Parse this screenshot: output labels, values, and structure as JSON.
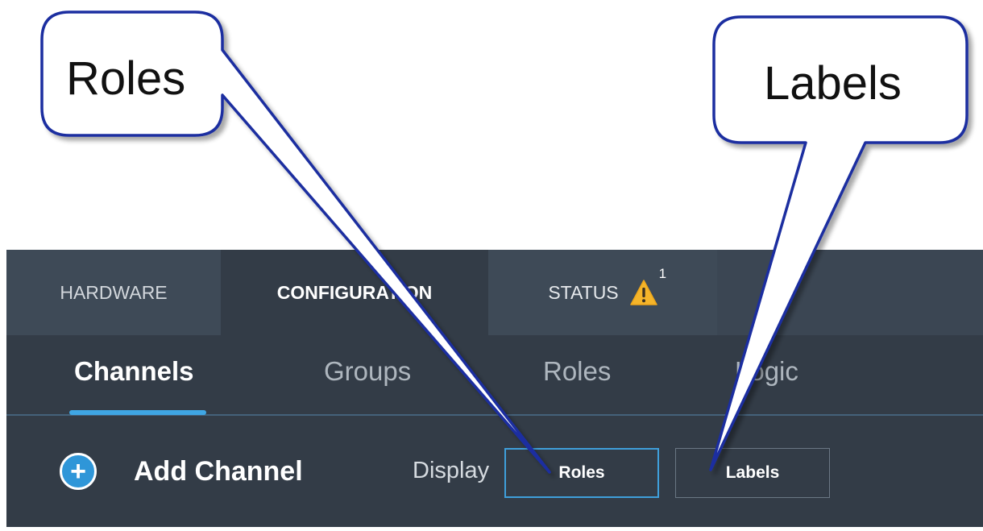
{
  "callouts": {
    "roles": "Roles",
    "labels": "Labels"
  },
  "top_tabs": {
    "hardware": "HARDWARE",
    "configuration": "CONFIGURATION",
    "status": "STATUS",
    "status_badge_count": "1"
  },
  "sub_tabs": {
    "channels": "Channels",
    "groups": "Groups",
    "roles": "Roles",
    "logic": "Logic"
  },
  "toolbar": {
    "add_icon": "+",
    "add_label": "Add Channel",
    "display_label": "Display",
    "roles_button": "Roles",
    "labels_button": "Labels"
  },
  "icons": {
    "add": "plus-circle-icon",
    "status": "warning-triangle-icon"
  },
  "colors": {
    "panel": "#333c47",
    "tab_bar": "#3b4653",
    "accent_blue": "#3fa6e4",
    "warning_yellow": "#f5b52a",
    "callout_border": "#1a2fa0"
  }
}
